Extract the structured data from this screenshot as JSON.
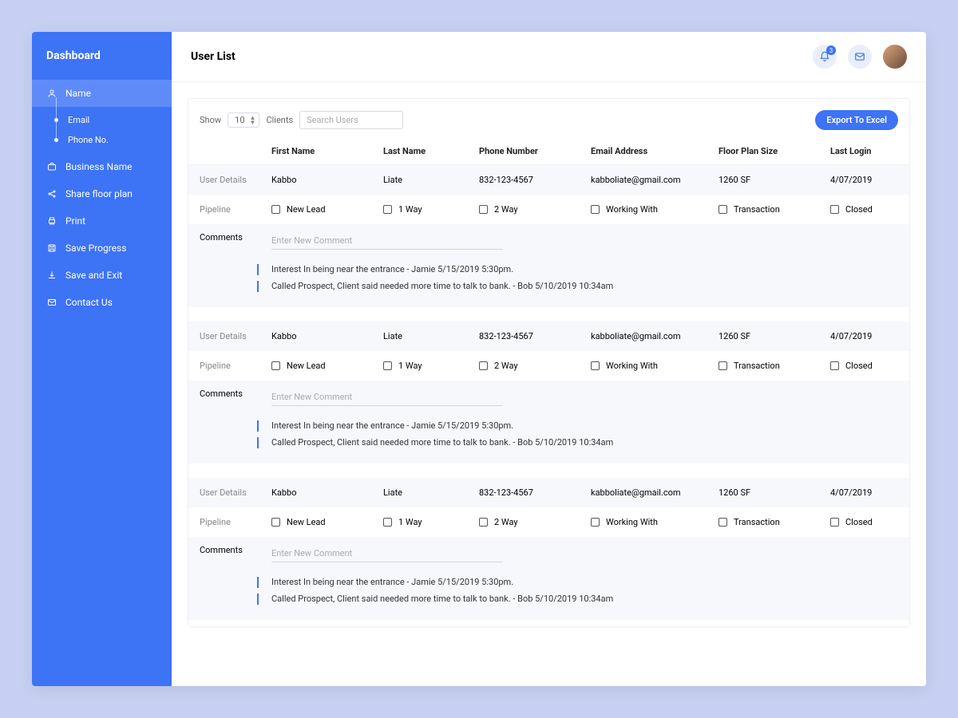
{
  "sidebar": {
    "title": "Dashboard",
    "name_item": "Name",
    "sub_email": "Email",
    "sub_phone": "Phone No.",
    "business": "Business Name",
    "share": "Share floor plan",
    "print": "Print",
    "save_progress": "Save Progress",
    "save_exit": "Save and Exit",
    "contact": "Contact Us"
  },
  "header": {
    "title": "User List",
    "notif_count": "3"
  },
  "controls": {
    "show_label": "Show",
    "show_value": "10",
    "clients_label": "Clients",
    "search_placeholder": "Search Users",
    "export_label": "Export To Excel"
  },
  "columns": {
    "first_name": "First Name",
    "last_name": "Last Name",
    "phone": "Phone Number",
    "email": "Email Address",
    "floor_plan": "Floor Plan Size",
    "last_login": "Last Login"
  },
  "row_labels": {
    "user_details": "User Details",
    "pipeline": "Pipeline",
    "comments": "Comments"
  },
  "pipeline": {
    "new_lead": "New Lead",
    "one_way": "1 Way",
    "two_way": "2 Way",
    "working_with": "Working With",
    "transaction": "Transaction",
    "closed": "Closed"
  },
  "comment_placeholder": "Enter New Comment",
  "comment1": "Interest In being near the entrance - Jamie 5/15/2019 5:30pm.",
  "comment2": "Called Prospect, Client said needed more time to talk to bank. - Bob 5/10/2019 10:34am",
  "users": {
    "u1": {
      "first": "Kabbo",
      "last": "Liate",
      "phone": "832-123-4567",
      "email": "kabboliate@gmail.com",
      "size": "1260 SF",
      "login": "4/07/2019"
    },
    "u2": {
      "first": "Kabbo",
      "last": "Liate",
      "phone": "832-123-4567",
      "email": "kabboliate@gmail.com",
      "size": "1260 SF",
      "login": "4/07/2019"
    },
    "u3": {
      "first": "Kabbo",
      "last": "Liate",
      "phone": "832-123-4567",
      "email": "kabboliate@gmail.com",
      "size": "1260 SF",
      "login": "4/07/2019"
    }
  }
}
